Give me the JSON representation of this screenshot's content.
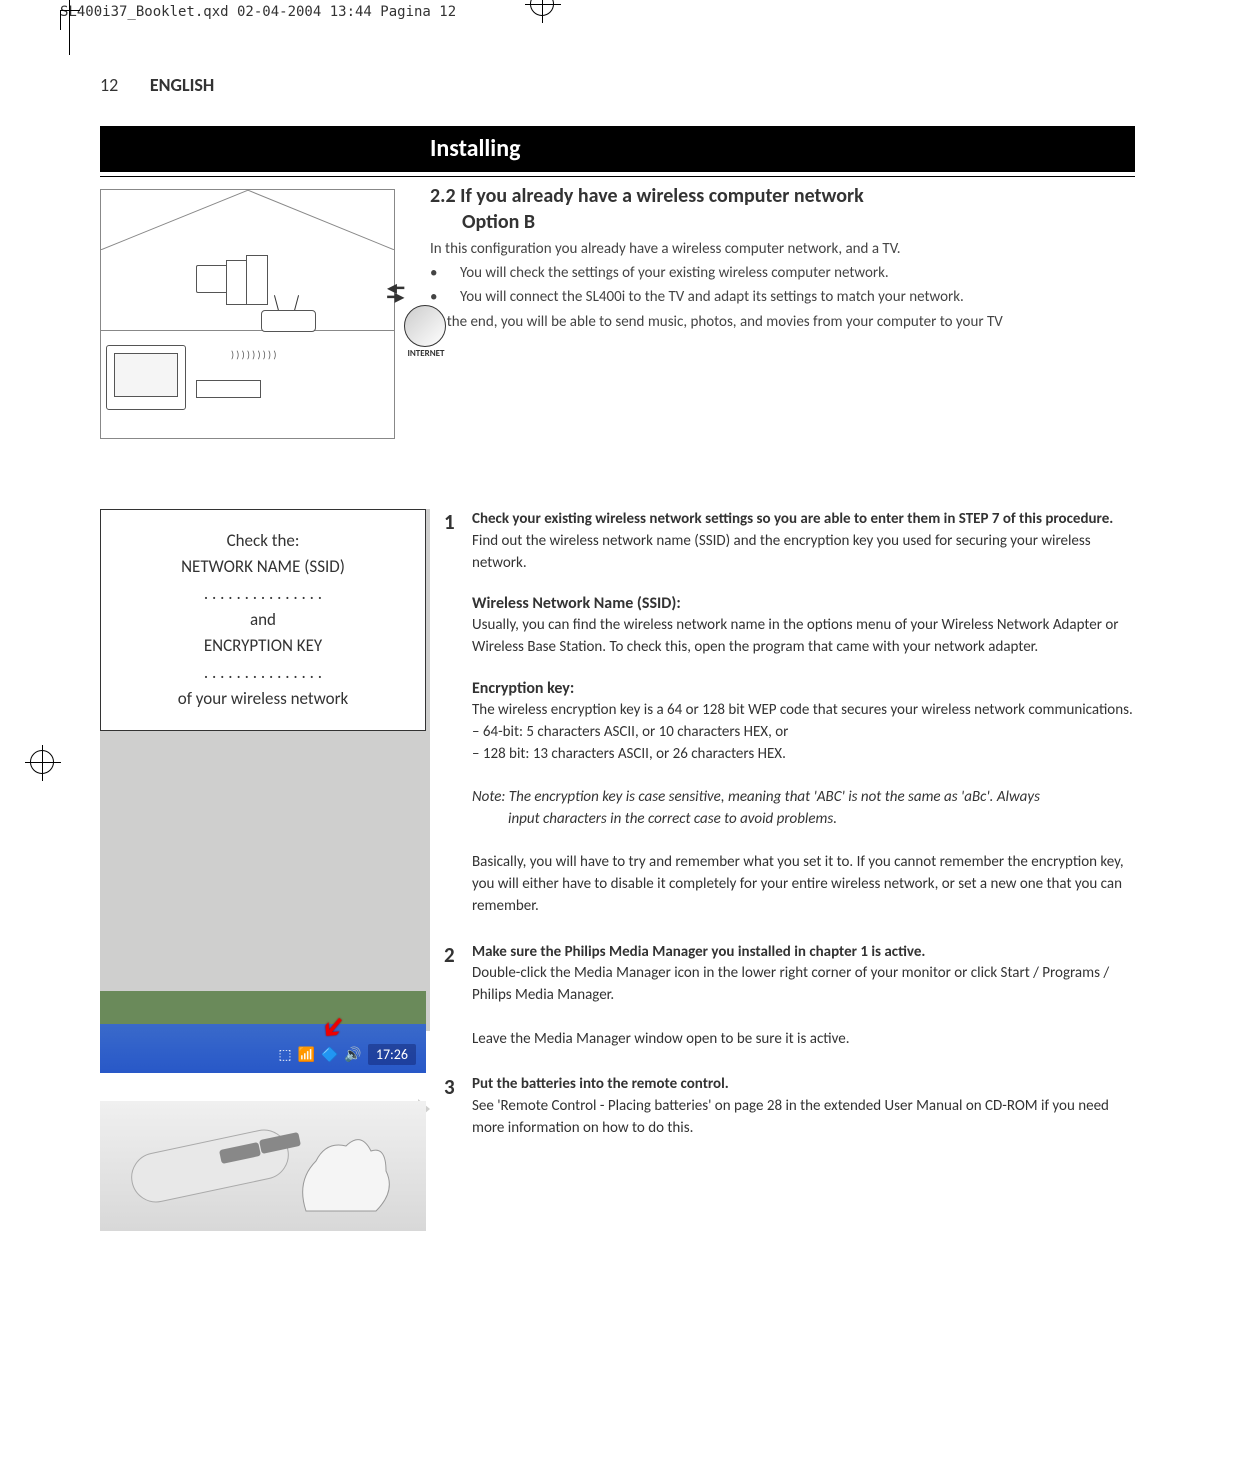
{
  "print_header": "SL400i37_Booklet.qxd  02-04-2004  13:44  Pagina 12",
  "page_number": "12",
  "language": "ENGLISH",
  "title": "Installing",
  "section": {
    "number_title": "2.2 If you already have a wireless computer network",
    "subtitle": "Option B",
    "intro": "In this configuration you already have a wireless computer network, and a TV.",
    "bullets": [
      "You will check the settings of your existing wireless computer network.",
      "You will connect the SL400i to the TV and adapt its settings to match your network."
    ],
    "outro": "At the end, you will be able to send music, photos, and movies from your computer to your TV"
  },
  "diagram": {
    "internet_label": "INTERNET"
  },
  "ssid_box": {
    "line1": "Check the:",
    "line2": "NETWORK NAME (SSID)",
    "dots1": ". . . . . . . . . . . . . . .",
    "line3": "and",
    "line4": "ENCRYPTION KEY",
    "dots2": ". . . . . . . . . . . . . . .",
    "line5": "of your wireless network"
  },
  "steps": {
    "s1": {
      "num": "1",
      "lead": "Check your existing wireless network settings so you are able to enter them in STEP 7 of this procedure.",
      "text1": "Find out the wireless network name (SSID) and the encryption key you used for securing your wireless network.",
      "ssid_heading": "Wireless Network Name (SSID):",
      "ssid_text": "Usually, you can find the wireless network name in the options menu of your Wireless Network Adapter or Wireless Base Station. To check this, open the program that came with your network adapter.",
      "enc_heading": "Encryption key:",
      "enc_text1": "The wireless encryption key is a 64 or 128 bit WEP code that secures your wireless network communications.",
      "enc_b1": "– 64-bit: 5 characters ASCII, or 10 characters HEX, or",
      "enc_b2": "– 128 bit: 13 characters ASCII, or 26 characters HEX.",
      "note_lead": "Note: The encryption key is case sensitive, meaning that 'ABC' is not the same as 'aBc'. Always",
      "note_cont": "input characters in the correct case to avoid problems.",
      "basically": "Basically, you will have to try and remember what you set it to. If you cannot remember the encryption key, you will either have to disable it completely for your entire wireless network, or set a new one that you can remember."
    },
    "s2": {
      "num": "2",
      "lead": "Make sure the Philips Media Manager you installed in chapter 1 is active.",
      "text1": "Double-click the Media Manager icon in the lower right corner of your monitor or click Start / Programs / Philips Media Manager.",
      "text2": "Leave the Media Manager window open to be sure it is active."
    },
    "s3": {
      "num": "3",
      "lead": "Put the batteries into the remote control.",
      "text1": "See 'Remote Control - Placing batteries' on page 28 in the extended User Manual on CD-ROM if you need more information on how to do this."
    }
  },
  "tray": {
    "time": "17:26"
  }
}
